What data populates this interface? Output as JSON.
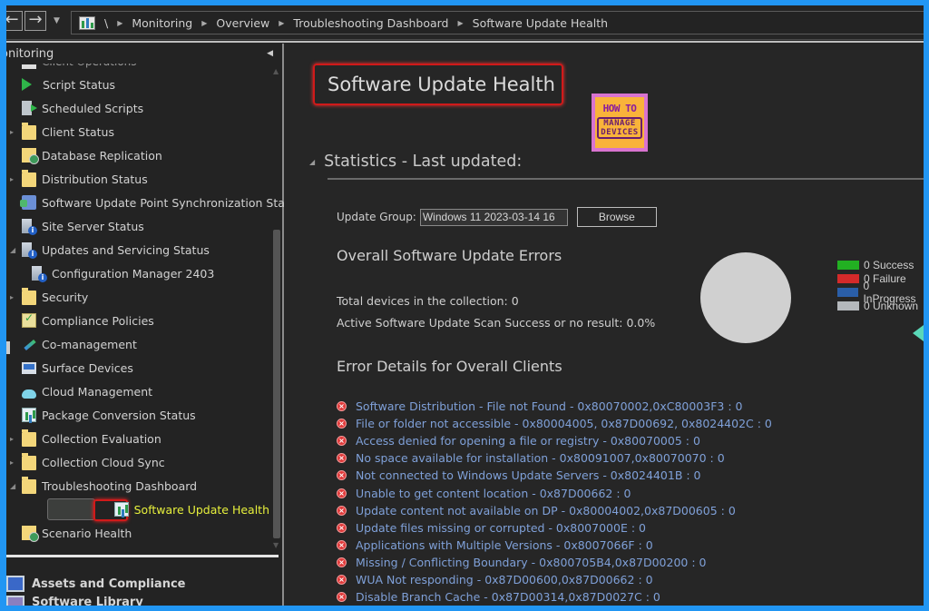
{
  "nav": {
    "back_icon": "arrow-left-icon",
    "forward_icon": "arrow-right-icon",
    "breadcrumb": [
      "\\",
      "Monitoring",
      "Overview",
      "Troubleshooting Dashboard",
      "Software Update Health"
    ]
  },
  "sidebar": {
    "header": "onitoring",
    "cutoff_item": "Client Operations",
    "items": [
      {
        "label": "Script Status",
        "icon": "play-icon",
        "expander": ""
      },
      {
        "label": "Scheduled Scripts",
        "icon": "scheduled-scripts-icon",
        "expander": ""
      },
      {
        "label": "Client Status",
        "icon": "folder-icon",
        "expander": "▸"
      },
      {
        "label": "Database Replication",
        "icon": "database-replication-icon",
        "expander": ""
      },
      {
        "label": "Distribution Status",
        "icon": "folder-icon",
        "expander": "▸"
      },
      {
        "label": "Software Update Point Synchronization Sta",
        "icon": "sup-sync-icon",
        "expander": ""
      },
      {
        "label": "Site Server Status",
        "icon": "server-info-icon",
        "expander": ""
      },
      {
        "label": "Updates and Servicing Status",
        "icon": "server-info-icon",
        "expander": "◢"
      },
      {
        "label": "Configuration Manager 2403",
        "icon": "server-info-icon",
        "expander": ""
      },
      {
        "label": "Security",
        "icon": "folder-icon",
        "expander": "▸"
      },
      {
        "label": "Compliance Policies",
        "icon": "compliance-check-icon",
        "expander": ""
      },
      {
        "label": "Co-management",
        "icon": "co-management-icon",
        "expander": ""
      },
      {
        "label": "Surface Devices",
        "icon": "surface-device-icon",
        "expander": ""
      },
      {
        "label": "Cloud Management",
        "icon": "cloud-icon",
        "expander": ""
      },
      {
        "label": "Package Conversion Status",
        "icon": "chart-icon",
        "expander": ""
      },
      {
        "label": "Collection Evaluation",
        "icon": "folder-icon",
        "expander": "▸"
      },
      {
        "label": "Collection Cloud Sync",
        "icon": "folder-icon",
        "expander": "▸"
      },
      {
        "label": "Troubleshooting Dashboard",
        "icon": "folder-icon",
        "expander": "◢"
      },
      {
        "label": "Software Update Health",
        "icon": "chart-icon",
        "expander": "",
        "selected": true
      },
      {
        "label": "Scenario Health",
        "icon": "scenario-health-icon",
        "expander": ""
      }
    ],
    "workspaces": [
      "Assets and Compliance",
      "Software Library"
    ]
  },
  "main": {
    "title": "Software Update Health",
    "logo": {
      "top": "HOW TO",
      "line1": "MANAGE",
      "line2": "DEVICES"
    },
    "section_title": "Statistics - Last updated:",
    "update_group_label": "Update Group:",
    "update_group_value": "Windows 11 2023-03-14 16",
    "browse_label": "Browse",
    "overall_title": "Overall Software Update Errors",
    "total_devices": "Total devices in the collection: 0",
    "scan_success": "Active Software Update Scan Success or no result: 0.0%",
    "error_details_title": "Error Details for Overall Clients",
    "errors": [
      "Software Distribution - File not Found - 0x80070002,0xC80003F3 : 0",
      "File or folder not accessible - 0x80004005, 0x87D00692, 0x8024402C : 0",
      "Access denied for opening a file or registry - 0x80070005 : 0",
      "No space available for installation - 0x80091007,0x80070070 : 0",
      "Not connected to Windows Update Servers - 0x8024401B  : 0",
      "Unable to get content location - 0x87D00662  : 0",
      "Update content not available on DP - 0x80004002,0x87D00605 : 0",
      "Update files missing or corrupted - 0x8007000E : 0",
      "Applications with Multiple Versions - 0x8007066F : 0",
      "Missing / Conflicting Boundary - 0x800705B4,0x87D00200 : 0",
      "WUA Not responding - 0x87D00600,0x87D00662 : 0",
      "Disable Branch Cache - 0x87D00314,0x87D0027C : 0"
    ]
  },
  "chart_data": {
    "type": "pie",
    "title": "",
    "series": [
      {
        "name": "Success",
        "value": 0,
        "color": "#22b022"
      },
      {
        "name": "Failure",
        "value": 0,
        "color": "#d42a2a"
      },
      {
        "name": "InProgress",
        "value": 0,
        "color": "#2a5ea8"
      },
      {
        "name": "Unknown",
        "value": 0,
        "color": "#b4b8bc"
      }
    ],
    "legend_labels": [
      "0 Success",
      "0 Failure",
      "0 InProgress",
      "0 Unknown"
    ],
    "empty_fill": "#d0d0d0",
    "legend_position": "right"
  }
}
